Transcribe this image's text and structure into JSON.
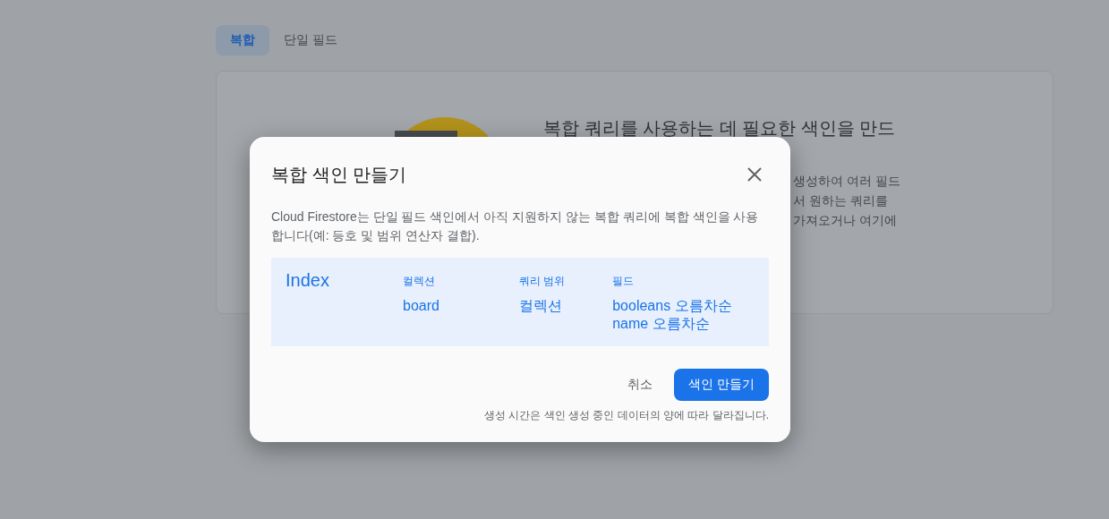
{
  "tabs": [
    {
      "label": "복합",
      "selected": true
    },
    {
      "label": "단일 필드",
      "selected": false
    }
  ],
  "card": {
    "heading": "복합 쿼리를 사용하는 데 필요한 색인을 만드",
    "body_fragments": [
      "생성하여 여러 필드",
      "서 원하는 쿼리를",
      "가져오거나 여기에"
    ]
  },
  "dialog": {
    "title": "복합 색인 만들기",
    "description": "Cloud Firestore는 단일 필드 색인에서 아직 지원하지 않는 복합 쿼리에 복합 색인을 사용합니다(예: 등호 및 범위 연산자 결합).",
    "index": {
      "label": "Index",
      "columns": [
        {
          "header": "컬렉션",
          "values": [
            "board"
          ]
        },
        {
          "header": "쿼리 범위",
          "values": [
            "컬렉션"
          ]
        },
        {
          "header": "필드",
          "values": [
            "booleans 오름차순",
            "name 오름차순"
          ]
        }
      ]
    },
    "buttons": [
      {
        "label": "취소",
        "kind": "text"
      },
      {
        "label": "색인 만들기",
        "kind": "primary"
      }
    ],
    "note": "생성 시간은 색인 생성 중인 데이터의 양에 따라 달라집니다."
  }
}
